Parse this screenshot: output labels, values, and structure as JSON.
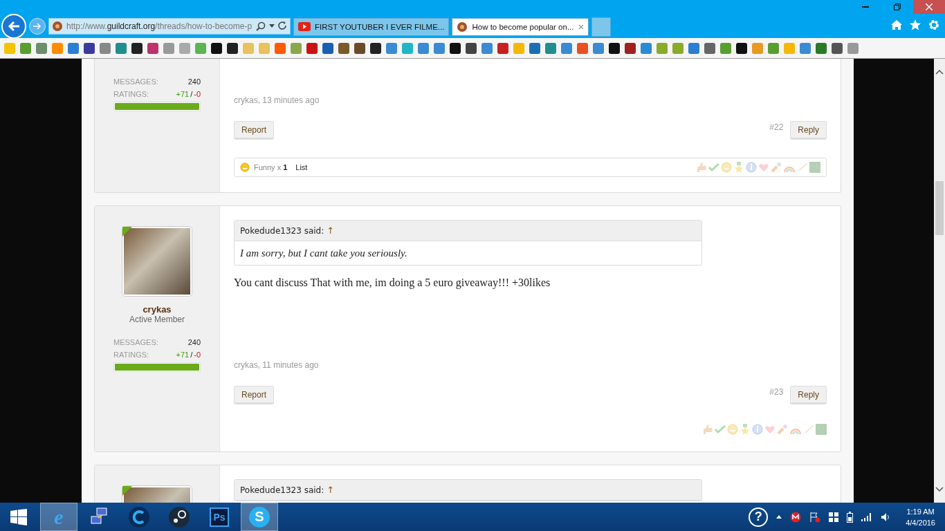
{
  "browser": {
    "address": "http://www.**guildcraft.org**/threads/how-to-become-p",
    "tabs": [
      {
        "title": "FIRST YOUTUBER I EVER FILME...",
        "selected": false
      },
      {
        "title": "How to become popular on...",
        "selected": true
      }
    ],
    "close_tab": "×"
  },
  "posts": [
    {
      "messages_label": "MESSAGES:",
      "messages": "240",
      "ratings_label": "RATINGS:",
      "ratings_positive": "+71",
      "ratings_separator": "/",
      "ratings_negative": "-0",
      "level": 1,
      "meta": "crykas, 13 minutes ago",
      "report": "Report",
      "number": "#22",
      "reply": "Reply",
      "reaction_summary": {
        "text": "Funny x **1**",
        "list": "List"
      }
    },
    {
      "online": true,
      "name": "crykas",
      "title": "Active Member",
      "messages_label": "MESSAGES:",
      "messages": "240",
      "ratings_label": "RATINGS:",
      "ratings_positive": "+71",
      "ratings_separator": "/",
      "ratings_negative": "-0",
      "level": 1,
      "quote": {
        "author": "Pokedude1323 said:",
        "arrow": "↑",
        "text": "I am sorry, but I cant take you seriously."
      },
      "body": "You cant discuss That with me, im doing a 5 euro giveaway!!! +30likes",
      "meta": "crykas, 11 minutes ago",
      "report": "Report",
      "number": "#23",
      "reply": "Reply"
    },
    {
      "online": true,
      "quote": {
        "author": "Pokedude1323 said:",
        "arrow": "↑"
      }
    }
  ],
  "taskbar": {
    "apps": [
      {
        "kind": "browser",
        "label": "e",
        "active": true
      },
      {
        "kind": "network",
        "active": false
      },
      {
        "kind": "cleaner",
        "active": false
      },
      {
        "kind": "steam",
        "active": false
      },
      {
        "kind": "ps",
        "label": "Ps",
        "active": false
      },
      {
        "kind": "skype",
        "label": "S",
        "active": true
      }
    ],
    "help": "?",
    "time": "1:19 AM",
    "date": "4/4/2016"
  }
}
